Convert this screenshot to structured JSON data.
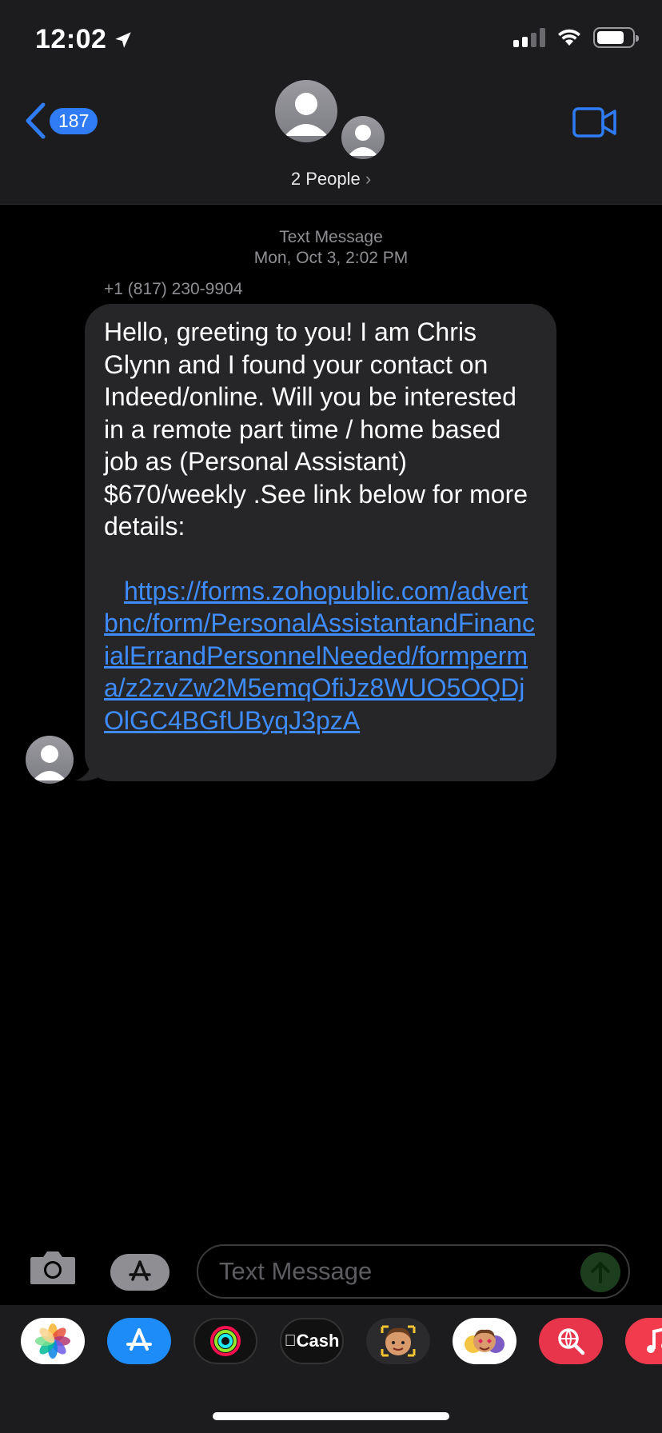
{
  "status_bar": {
    "time": "12:02"
  },
  "header": {
    "back_count": "187",
    "people_label": "2 People",
    "people_chevron": "›"
  },
  "conversation": {
    "service": "Text Message",
    "timestamp": "Mon, Oct 3, 2:02 PM",
    "sender": "+1 (817) 230-9904",
    "message_text": "Hello, greeting to you! I am Chris Glynn and I found your contact on Indeed/online. Will you be interested in a remote part time / home based job as (Personal Assistant) $670/weekly .See link below for more details:",
    "message_link": "https://forms.zohopublic.com/advertbnc/form/PersonalAssistantandFinancialErrandPersonnelNeeded/formperma/z2zvZw2M5emqOfiJz8WUO5OQDjOlGC4BGfUByqJ3pzA"
  },
  "composer": {
    "placeholder": "Text Message"
  },
  "app_drawer": {
    "apps": [
      {
        "name": "photos-app-icon"
      },
      {
        "name": "app-store-icon"
      },
      {
        "name": "activity-app-icon"
      },
      {
        "name": "apple-cash-icon",
        "label": "Cash"
      },
      {
        "name": "memoji-app-icon"
      },
      {
        "name": "memoji-stickers-icon"
      },
      {
        "name": "images-search-icon"
      },
      {
        "name": "music-app-icon"
      }
    ]
  },
  "colors": {
    "accent": "#2f7cf6",
    "link": "#3f8cff",
    "bubble": "#262628",
    "header_bg": "#1c1c1e"
  }
}
